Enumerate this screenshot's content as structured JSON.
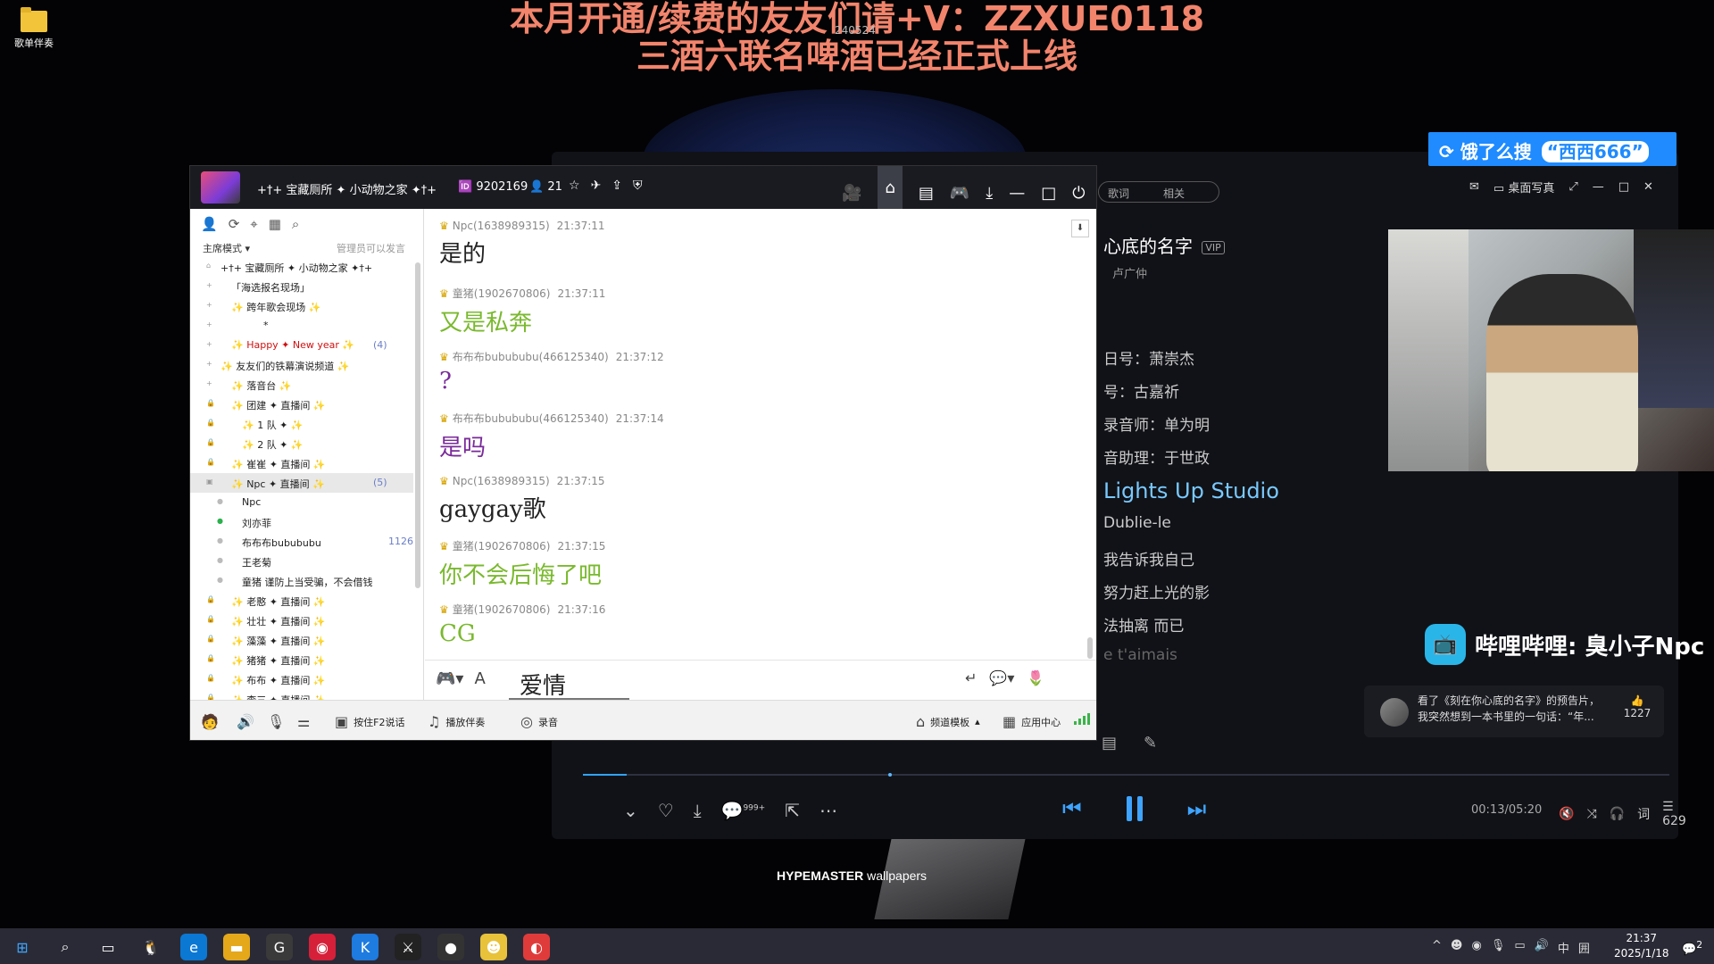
{
  "desktop": {
    "icon_label": "歌单伴奏",
    "banner_line1": "本月开通/续费的友友们请+V：ZZXUE0118",
    "banner_line2": "三酒六联名啤酒已经正式上线",
    "banner_small": "240524",
    "wallpaper_brand_bold": "HYPEMASTER",
    "wallpaper_brand_rest": "wallpapers"
  },
  "search_banner": {
    "prefix": "饿了么搜",
    "query": "“西西666”"
  },
  "music_player": {
    "pill_left": "歌词",
    "pill_right": "相关",
    "top_right_desktop_lyric": "桌面写真",
    "song_title": "心底的名字",
    "vip_badge": "VIP",
    "singer": "卢广仲",
    "credits": [
      "和声编写：萧崇杰",
      "和声：古嘉祈",
      "录音师：单为明",
      "录音助理：于世政",
      "Lights Up Studio",
      "Dublie-le",
      "我告诉我自己",
      "努力赶上光的影",
      "无法抽离 而已",
      "Je t'aimais"
    ],
    "credit_visible": [
      "日号：萧崇杰",
      "号：古嘉祈",
      "录音师：单为明",
      "音助理：于世政",
      "Lights Up Studio",
      "Dublie-le",
      "我告诉我自己",
      "努力赶上光的影",
      "法抽离 而已",
      "e t'aimais"
    ],
    "progress_fraction": 0.04,
    "time": "00:13/05:20",
    "comment_count_badge": "999+",
    "playlist_count": "629",
    "lyric_mode_label": "词"
  },
  "bilibili": {
    "label": "哔哩哔哩: 臭小子Npc"
  },
  "comment": {
    "text": "看了《刻在你心底的名字》的预告片，我突然想到一本书里的一句话：“年...",
    "likes": "1227"
  },
  "yy": {
    "channel_name": "+†+ 宝藏厕所 ✦ 小动物之家 ✦†+",
    "channel_id": "9202169",
    "online_count": "21",
    "mode_label": "主席模式",
    "admin_note": "管理员可以发言",
    "tree": [
      {
        "text": "+†+ 宝藏厕所 ✦ 小动物之家 ✦†+",
        "indent": 0,
        "icon": "home"
      },
      {
        "text": "「海选报名现场」",
        "indent": 1,
        "icon": "plus"
      },
      {
        "text": "✨   跨年歌会现场   ✨",
        "indent": 1,
        "icon": "plus"
      },
      {
        "text": "*",
        "indent": 4,
        "icon": "plus"
      },
      {
        "text": "✨ Happy ✦ New year ✨",
        "indent": 1,
        "icon": "plus",
        "count": "(4)",
        "color": "#d01010"
      },
      {
        "text": "✨ 友友们的铁幕演说频道 ✨",
        "indent": 0,
        "icon": "plus"
      },
      {
        "text": "✨     落音台     ✨",
        "indent": 1,
        "icon": "plus"
      },
      {
        "text": "✨   团建 ✦ 直播间   ✨",
        "indent": 1,
        "icon": "lock"
      },
      {
        "text": "✨    1  队   ✦    ✨",
        "indent": 2,
        "icon": "lock"
      },
      {
        "text": "✨    2  队   ✦    ✨",
        "indent": 2,
        "icon": "lock"
      },
      {
        "text": "✨   崔崔 ✦ 直播间   ✨",
        "indent": 1,
        "icon": "lock"
      },
      {
        "text": "✨   Npc  ✦ 直播间   ✨",
        "indent": 1,
        "icon": "open",
        "count": "(5)",
        "selected": true
      },
      {
        "text": "Npc",
        "indent": 2,
        "icon": "user"
      },
      {
        "text": "刘亦菲",
        "indent": 2,
        "icon": "user"
      },
      {
        "text": "布布布bubububu",
        "indent": 2,
        "icon": "user",
        "count": "1126"
      },
      {
        "text": "王老菊",
        "indent": 2,
        "icon": "user"
      },
      {
        "text": "童猪  谨防上当受骗，不会借钱",
        "indent": 2,
        "icon": "user"
      },
      {
        "text": "✨   老憨 ✦ 直播间   ✨",
        "indent": 1,
        "icon": "lock"
      },
      {
        "text": "✨   壮壮 ✦ 直播间   ✨",
        "indent": 1,
        "icon": "lock"
      },
      {
        "text": "✨   藻藻 ✦ 直播间   ✨",
        "indent": 1,
        "icon": "lock"
      },
      {
        "text": "✨   猪猪 ✦ 直播间   ✨",
        "indent": 1,
        "icon": "lock"
      },
      {
        "text": "✨   布布 ✦ 直播间   ✨",
        "indent": 1,
        "icon": "lock"
      },
      {
        "text": "✨   李三 ✦ 直播间   ✨",
        "indent": 1,
        "icon": "lock"
      }
    ],
    "messages": [
      {
        "user": "Npc(1638989315)",
        "time": "21:37:11",
        "text": "是的",
        "color": "#222222"
      },
      {
        "user": "童猪(1902670806)",
        "time": "21:37:11",
        "text": "又是私奔",
        "color": "#7ab92e"
      },
      {
        "user": "布布布bubububu(466125340)",
        "time": "21:37:12",
        "text": "?",
        "color": "#7a2a9a"
      },
      {
        "user": "布布布bubububu(466125340)",
        "time": "21:37:14",
        "text": "是吗",
        "color": "#7a2a9a"
      },
      {
        "user": "Npc(1638989315)",
        "time": "21:37:15",
        "text": "gaygay歌",
        "color": "#222222"
      },
      {
        "user": "童猪(1902670806)",
        "time": "21:37:15",
        "text": "你不会后悔了吧",
        "color": "#7ab92e"
      },
      {
        "user": "童猪(1902670806)",
        "time": "21:37:16",
        "text": "CG",
        "color": "#7ab92e"
      }
    ],
    "input_text": "爱情",
    "bottom": {
      "ptt_label": "按住F2说话",
      "accompany_label": "播放伴奏",
      "record_label": "录音",
      "template_label": "频道模板",
      "app_center_label": "应用中心"
    }
  },
  "taskbar": {
    "time": "21:37",
    "date": "2025/1/18",
    "ime": "中",
    "notif_count": "2"
  }
}
